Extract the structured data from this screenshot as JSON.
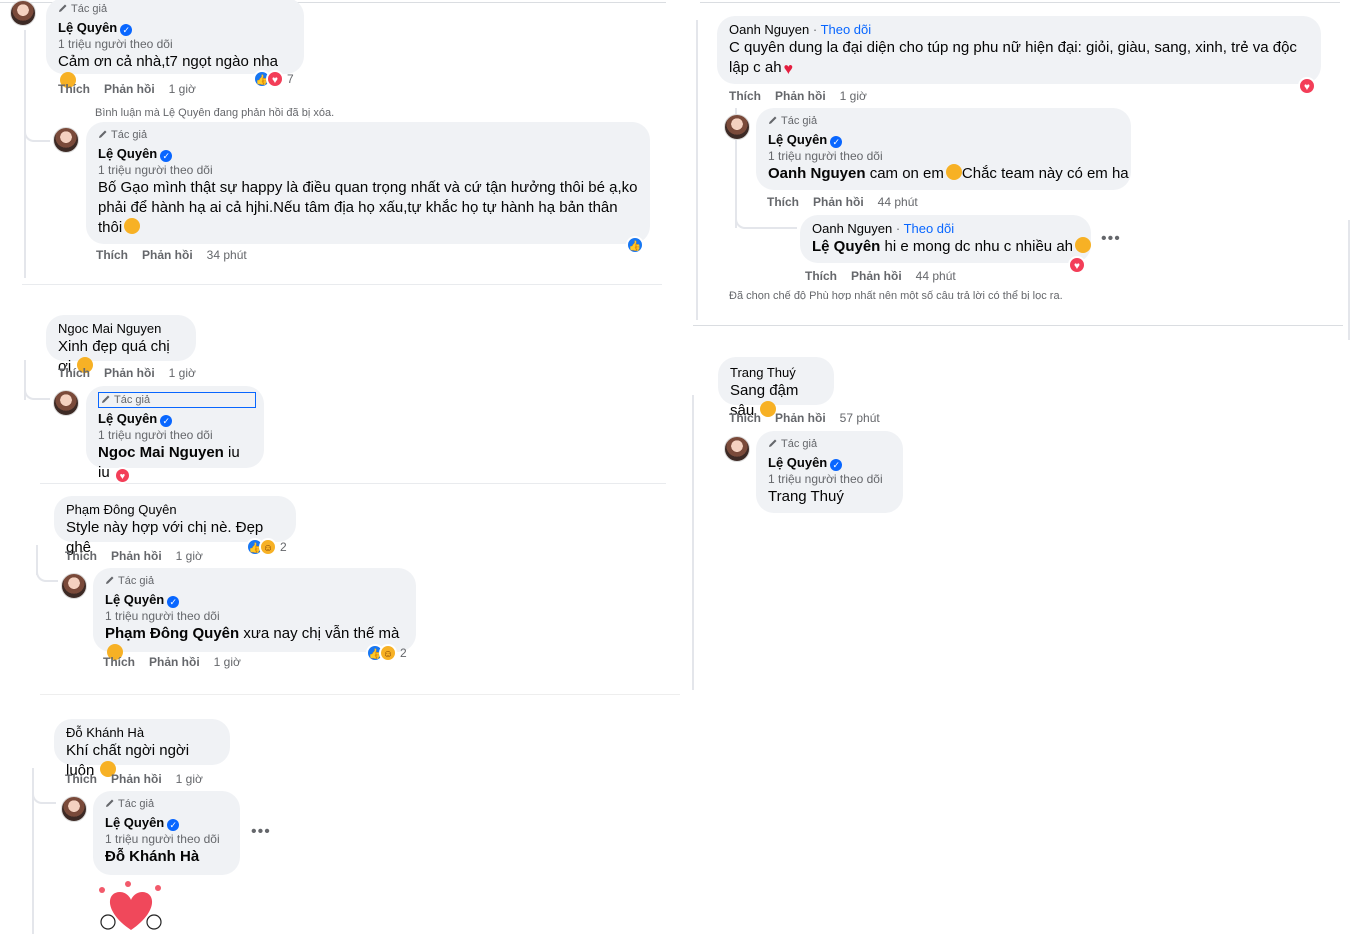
{
  "common": {
    "author_tag": "Tác giả",
    "author_name": "Lệ Quyên",
    "followers": "1 triệu người theo dõi",
    "like": "Thích",
    "reply": "Phản hồi",
    "follow": "Theo dõi"
  },
  "left": {
    "c1": {
      "text": "Cảm ơn cả nhà,t7 ngọt ngào nha",
      "time": "1 giờ",
      "react_count": "7"
    },
    "c1_deleted_note": "Bình luận mà Lệ Quyên đang phản hồi đã bị xóa.",
    "c1_reply": {
      "text": "Bố Gạo mình thật sự happy là điều quan trọng nhất và cứ tận hưởng thôi bé ạ,ko phải để hành hạ ai cả hjhi.Nếu tâm địa họ xấu,tự khắc họ tự hành hạ bản thân thôi",
      "time": "34 phút"
    },
    "c2": {
      "name": "Ngoc Mai Nguyen",
      "text": "Xinh đẹp quá chị ơi",
      "time": "1 giờ"
    },
    "c2_reply": {
      "mention": "Ngoc Mai Nguyen",
      "text": "iu iu"
    },
    "c3": {
      "name": "Phạm Đông Quyên",
      "text": "Style này hợp với chị nè. Đẹp ghê",
      "time": "1 giờ",
      "react_count": "2"
    },
    "c3_reply": {
      "mention": "Phạm Đông Quyên",
      "text": "xưa nay chị vẫn thế mà",
      "time": "1 giờ",
      "react_count": "2"
    },
    "c4": {
      "name": "Đỗ Khánh Hà",
      "text": "Khí chất ngời ngời luôn",
      "time": "1 giờ"
    },
    "c4_reply": {
      "mention": "Đỗ Khánh Hà"
    }
  },
  "right": {
    "c1": {
      "name": "Oanh Nguyen",
      "text": "C quyên dung la đại diện cho túp ng phu nữ hiện đại: giỏi, giàu, sang, xinh, trẻ va độc lập c ah",
      "time": "1 giờ"
    },
    "c1_reply": {
      "mention": "Oanh Nguyen",
      "text": "cam on em",
      "text2": "Chắc team này có em ha",
      "time": "44 phút"
    },
    "c1_reply2": {
      "name": "Oanh Nguyen",
      "mention": "Lệ Quyên",
      "text": "hi e mong dc nhu c nhiều ah",
      "time": "44 phút"
    },
    "filter_note": "Đã chọn chế độ Phù hợp nhất nên một số câu trả lời có thể bị lọc ra.",
    "c2": {
      "name": "Trang Thuý",
      "text": "Sang đậm sâu",
      "time": "57 phút"
    },
    "c2_reply": {
      "mention": "Trang Thuý"
    }
  },
  "icons": [
    "pencil-icon",
    "verified-badge-icon",
    "like-reaction-icon",
    "love-reaction-icon",
    "care-reaction-icon",
    "more-options-icon",
    "heart-sticker"
  ],
  "colors": {
    "bubble": "#f0f2f5",
    "link": "#0866ff",
    "muted": "#65676b",
    "like": "#1877f2",
    "love": "#f33e58"
  }
}
